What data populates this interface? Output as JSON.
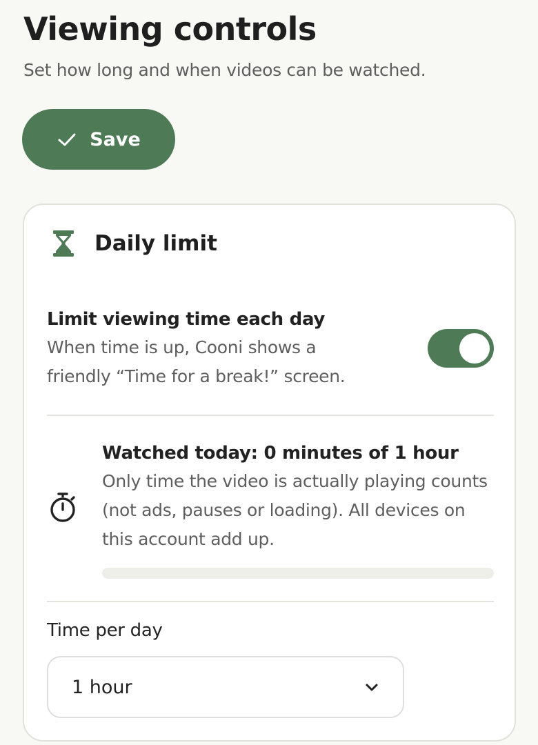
{
  "page": {
    "title": "Viewing controls",
    "subtitle": "Set how long and when videos can be watched."
  },
  "toolbar": {
    "save_label": "Save",
    "save_icon": "check-icon"
  },
  "daily_limit": {
    "title": "Daily limit",
    "icon": "hourglass-icon",
    "limit_toggle": {
      "title": "Limit viewing time each day",
      "description": "When time is up, Cooni shows a friendly “Time for a break!” screen.",
      "enabled": true
    },
    "usage": {
      "icon": "stopwatch-icon",
      "title": "Watched today: 0 minutes of 1 hour",
      "description": "Only time the video is actually playing counts (not ads, pauses or loading). All devices on this account add up.",
      "progress_fraction": 0
    },
    "time_per_day": {
      "label": "Time per day",
      "selected": "1 hour"
    }
  },
  "colors": {
    "accent": "#4e7a56",
    "background": "#f8f8f4",
    "card": "#ffffff",
    "text": "#222222",
    "muted_text": "#5e5e5e"
  }
}
